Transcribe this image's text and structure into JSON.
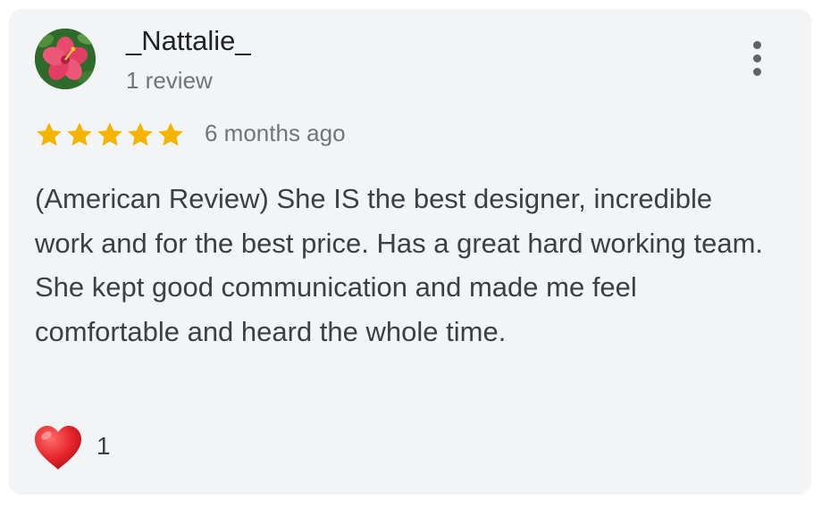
{
  "review": {
    "reviewer_name": "_Nattalie_",
    "review_count": "1 review",
    "rating": 5,
    "rating_max": 5,
    "time_ago": "6 months ago",
    "text": "(American Review) She IS the best designer, incredible work and for the best price. Has a great hard working team. She kept good communication and made me feel comfortable and heard the whole time.",
    "reaction_icon": "heart-icon",
    "reaction_count": "1",
    "avatar_icon": "hibiscus-flower-avatar",
    "menu_icon": "more-vert-icon"
  },
  "colors": {
    "card_background": "#f3f4f6",
    "star": "#f4b400",
    "heart": "#e5252a",
    "primary_text": "#202124",
    "secondary_text": "#70757a"
  }
}
